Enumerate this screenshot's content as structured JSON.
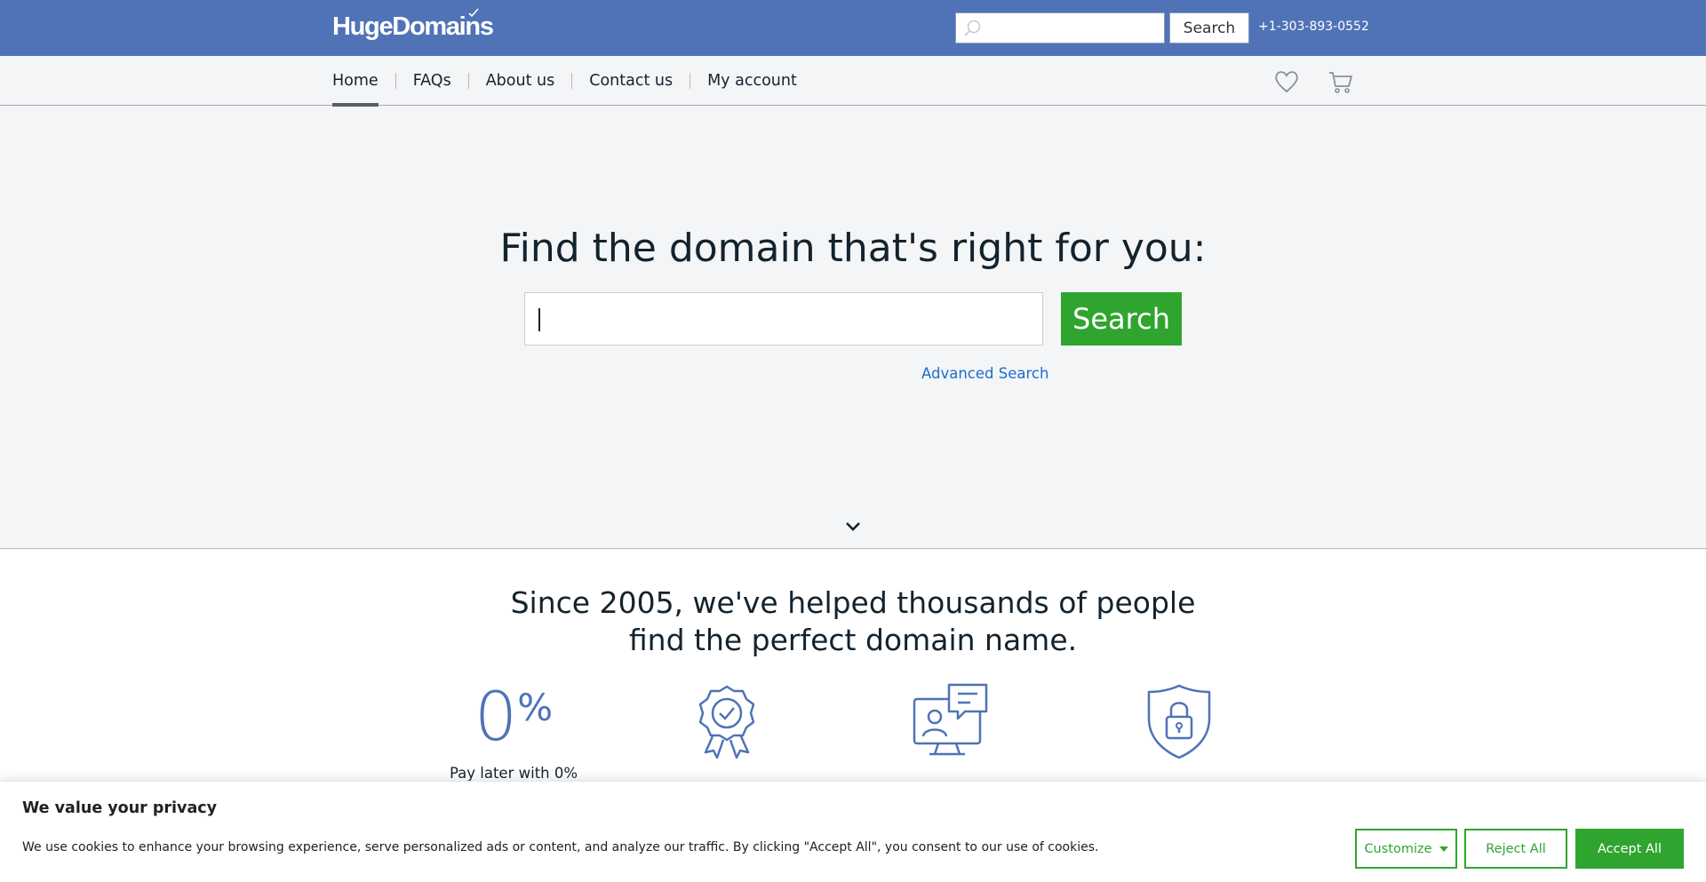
{
  "header": {
    "logo_text": "HugeDomains",
    "search_button": "Search",
    "search_placeholder": "",
    "phone": "+1-303-893-0552",
    "brand_color": "#4f73b6"
  },
  "nav": {
    "items": [
      {
        "label": "Home",
        "active": true
      },
      {
        "label": "FAQs"
      },
      {
        "label": "About us"
      },
      {
        "label": "Contact us"
      },
      {
        "label": "My account"
      }
    ],
    "icons": [
      "heart-icon",
      "cart-icon"
    ]
  },
  "hero": {
    "title": "Find the domain that's right for you:",
    "search_value": "",
    "search_button": "Search",
    "advanced_link": "Advanced Search",
    "accent_color": "#2fa52f"
  },
  "lower": {
    "heading_line1": "Since 2005, we've helped thousands of people",
    "heading_line2": "find the perfect domain name.",
    "features": [
      {
        "icon": "zero-percent-icon",
        "big": "0",
        "pct": "%",
        "caption": "Pay later with 0%"
      },
      {
        "icon": "award-ribbon-icon",
        "caption": ""
      },
      {
        "icon": "support-chat-icon",
        "caption": ""
      },
      {
        "icon": "shield-lock-icon",
        "caption": ""
      }
    ]
  },
  "cookie": {
    "title": "We value your privacy",
    "text": "We use cookies to enhance your browsing experience, serve personalized ads or content, and analyze our traffic. By clicking \"Accept All\", you consent to our use of cookies.",
    "customize": "Customize",
    "reject": "Reject All",
    "accept": "Accept All"
  }
}
